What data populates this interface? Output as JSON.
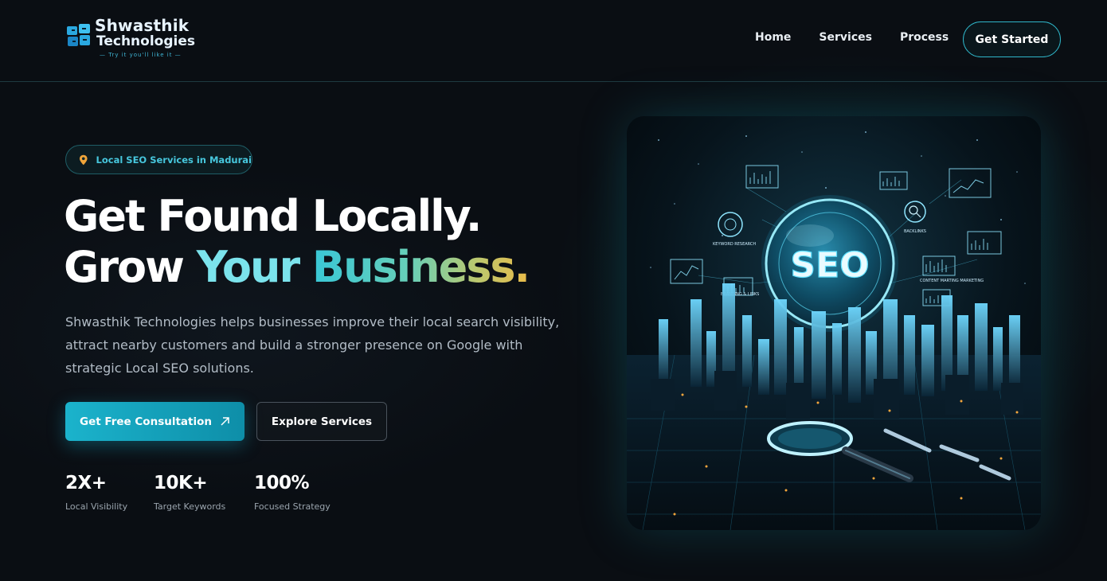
{
  "brand": {
    "name_line1": "Shwasthik",
    "name_line2": "Technologies",
    "tagline": "— Try it you'll like it —"
  },
  "nav": {
    "items": [
      {
        "label": "Home"
      },
      {
        "label": "Services"
      },
      {
        "label": "Process"
      }
    ],
    "cta_label": "Get Started"
  },
  "hero": {
    "badge": {
      "icon": "map-pin-icon",
      "text": "Local SEO Services in Madurai"
    },
    "title_line1": "Get Found Locally.",
    "title_grow": "Grow",
    "title_your": "Your",
    "title_business": "Business.",
    "description": "Shwasthik Technologies helps businesses improve their local search visibility, attract nearby customers and build a stronger presence on Google with strategic Local SEO solutions.",
    "primary_button": {
      "label": "Get Free Consultation",
      "icon": "arrow-up-right-icon"
    },
    "secondary_button": {
      "label": "Explore Services"
    },
    "stats": [
      {
        "value": "2X+",
        "label": "Local Visibility"
      },
      {
        "value": "10K+",
        "label": "Target Keywords"
      },
      {
        "value": "100%",
        "label": "Focused Strategy"
      }
    ]
  },
  "illustration": {
    "center_text": "SEO",
    "labels": [
      "KEYWORD RESEARCH",
      "BACKLINKS",
      "CONTENT MARTING MARKETING",
      "BRANDING & LINKS"
    ]
  },
  "colors": {
    "accent": "#1bb3cc",
    "background": "#0a0e13",
    "gradient_gold": "#e9bb49"
  }
}
